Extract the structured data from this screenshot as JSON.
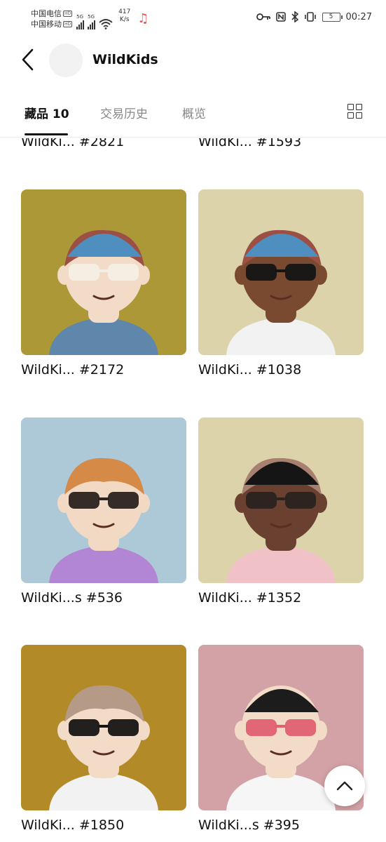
{
  "status_bar": {
    "carrier1": "中国电信",
    "carrier2": "中国移动",
    "hd_badge": "HD",
    "network1": "5G",
    "network2": "5G",
    "speed_value": "417",
    "speed_unit": "K/s",
    "battery": "5",
    "time": "00:27"
  },
  "header": {
    "title": "WildKids"
  },
  "tabs": [
    {
      "label": "藏品 10"
    },
    {
      "label": "交易历史"
    },
    {
      "label": "概览"
    }
  ],
  "items": {
    "partial": [
      {
        "name": "WildKi... #2821"
      },
      {
        "name": "WildKi... #1593"
      }
    ],
    "cards": [
      {
        "name": "WildKi... #2172",
        "bg": "#ad9838",
        "skin": "#f2dcc8",
        "hair": "#9b4f45",
        "hat": "#4f8fbf",
        "glasses": "#f4efe5",
        "shirt": "#5f86ab"
      },
      {
        "name": "WildKi... #1038",
        "bg": "#dcd3ab",
        "skin": "#7a4a30",
        "hair": "#9b4f45",
        "hat": "#4f8fbf",
        "glasses": "#151515",
        "shirt": "#f2f2f2"
      },
      {
        "name": "WildKi...s #536",
        "bg": "#adc9d8",
        "skin": "#f2d9c4",
        "hair": "#d68a48",
        "hat": "",
        "glasses": "#2a2320",
        "shirt": "#b286d4"
      },
      {
        "name": "WildKi... #1352",
        "bg": "#dcd3ab",
        "skin": "#6a4030",
        "hair": "#a88070",
        "hat": "#151515",
        "glasses": "#2a2320",
        "shirt": "#f0c2c8"
      },
      {
        "name": "WildKi... #1850",
        "bg": "#b38a28",
        "skin": "#f2dcc8",
        "hair": "#b59a88",
        "hat": "",
        "glasses": "#151515",
        "shirt": "#f2f2f2"
      },
      {
        "name": "WildKi...s #395",
        "bg": "#d2a2a6",
        "skin": "#f2dcc8",
        "hair": "",
        "hat": "#1c1c1c",
        "glasses": "#e06070",
        "shirt": "#f6f6f6"
      }
    ]
  },
  "icons": {
    "back": "chevron-left-icon",
    "grid": "grid-view-icon",
    "scroll_top": "chevron-up-icon"
  }
}
